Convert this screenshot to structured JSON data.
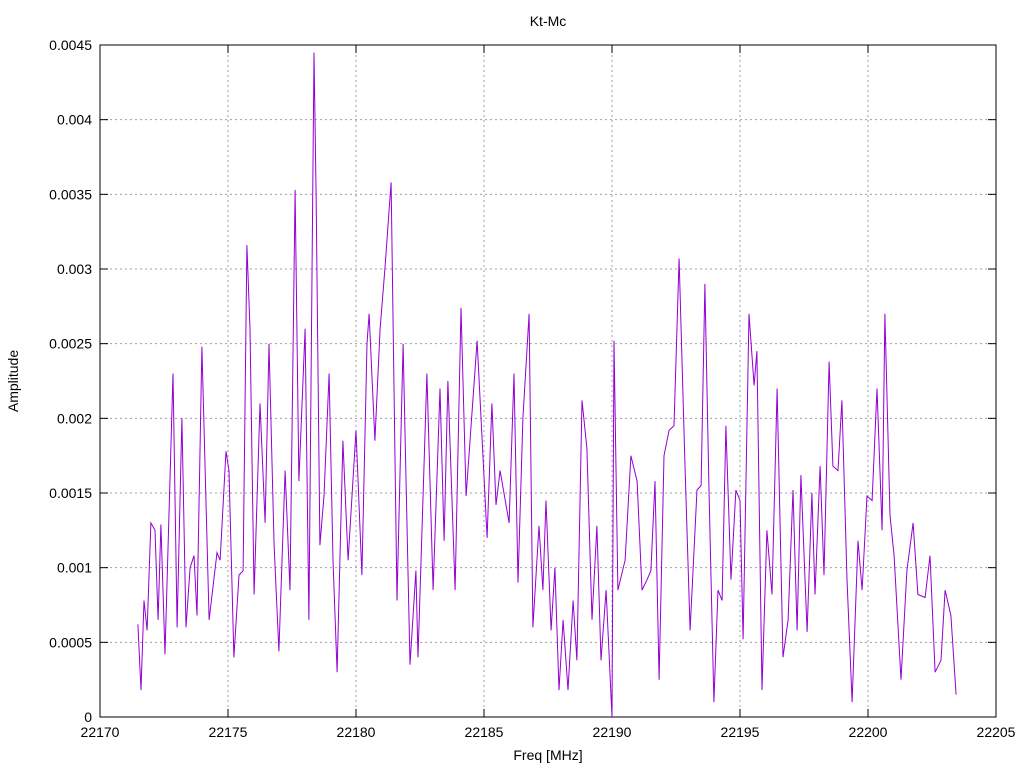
{
  "chart_data": {
    "type": "line",
    "title": "Kt-Mc",
    "xlabel": "Freq [MHz]",
    "ylabel": "Amplitude",
    "xlim": [
      22170,
      22205
    ],
    "ylim": [
      0,
      0.0045
    ],
    "xticks": [
      "22170",
      "22175",
      "22180",
      "22185",
      "22190",
      "22195",
      "22200",
      "22205"
    ],
    "yticks": [
      "0",
      "0.0005",
      "0.001",
      "0.0015",
      "0.002",
      "0.0025",
      "0.003",
      "0.0035",
      "0.004",
      "0.0045"
    ],
    "grid": true,
    "legend": "none",
    "series": [
      {
        "name": "Kt-Mc",
        "color": "#9400d3",
        "x": [
          22171.48,
          22171.6,
          22171.72,
          22171.84,
          22171.99,
          22172.15,
          22172.27,
          22172.38,
          22172.54,
          22172.66,
          22172.85,
          22173.01,
          22173.2,
          22173.36,
          22173.52,
          22173.67,
          22173.79,
          22173.98,
          22174.26,
          22174.57,
          22174.69,
          22174.92,
          22175.04,
          22175.23,
          22175.43,
          22175.59,
          22175.74,
          22175.86,
          22176.02,
          22176.25,
          22176.45,
          22176.6,
          22176.8,
          22176.99,
          22177.23,
          22177.42,
          22177.62,
          22177.77,
          22178.01,
          22178.16,
          22178.36,
          22178.44,
          22178.59,
          22178.75,
          22178.95,
          22179.1,
          22179.26,
          22179.49,
          22179.69,
          22180.0,
          22180.23,
          22180.43,
          22180.51,
          22180.74,
          22180.94,
          22181.13,
          22181.37,
          22181.6,
          22181.84,
          22182.11,
          22182.34,
          22182.42,
          22182.77,
          22183.01,
          22183.28,
          22183.44,
          22183.59,
          22183.87,
          22184.1,
          22184.3,
          22184.73,
          22185.12,
          22185.31,
          22185.47,
          22185.63,
          22185.98,
          22186.17,
          22186.33,
          22186.52,
          22186.76,
          22186.91,
          22187.15,
          22187.3,
          22187.42,
          22187.62,
          22187.77,
          22187.93,
          22188.09,
          22188.28,
          22188.48,
          22188.63,
          22188.83,
          22189.02,
          22189.22,
          22189.41,
          22189.57,
          22189.77,
          22190.0,
          22190.08,
          22190.23,
          22190.51,
          22190.74,
          22190.98,
          22191.17,
          22191.37,
          22191.52,
          22191.68,
          22191.84,
          22192.03,
          22192.23,
          22192.42,
          22192.62,
          22192.85,
          22193.05,
          22193.32,
          22193.48,
          22193.63,
          22193.79,
          22193.98,
          22194.14,
          22194.3,
          22194.45,
          22194.65,
          22194.84,
          22195.0,
          22195.12,
          22195.35,
          22195.55,
          22195.66,
          22195.86,
          22196.05,
          22196.25,
          22196.45,
          22196.68,
          22196.88,
          22197.07,
          22197.23,
          22197.38,
          22197.62,
          22197.81,
          22197.93,
          22198.13,
          22198.28,
          22198.48,
          22198.63,
          22198.83,
          22198.98,
          22199.18,
          22199.38,
          22199.61,
          22199.77,
          22199.96,
          22200.16,
          22200.35,
          22200.55,
          22200.66,
          22200.86,
          22201.02,
          22201.29,
          22201.52,
          22201.76,
          22201.95,
          22202.23,
          22202.42,
          22202.62,
          22202.85,
          22203.01,
          22203.24,
          22203.44
        ],
        "y": [
          0.00062,
          0.00018,
          0.00078,
          0.00058,
          0.0013,
          0.00125,
          0.00065,
          0.00129,
          0.00042,
          0.00115,
          0.0023,
          0.0006,
          0.002,
          0.0006,
          0.001,
          0.00108,
          0.00068,
          0.00248,
          0.00065,
          0.0011,
          0.00105,
          0.00178,
          0.00165,
          0.0004,
          0.00095,
          0.00098,
          0.00316,
          0.0026,
          0.00082,
          0.0021,
          0.0013,
          0.0025,
          0.00115,
          0.00044,
          0.00165,
          0.00085,
          0.00353,
          0.00158,
          0.0026,
          0.00065,
          0.00445,
          0.0035,
          0.00115,
          0.00148,
          0.0023,
          0.00105,
          0.0003,
          0.00185,
          0.00105,
          0.00192,
          0.00095,
          0.0025,
          0.0027,
          0.00185,
          0.0026,
          0.003,
          0.00358,
          0.00078,
          0.0025,
          0.00035,
          0.00098,
          0.0004,
          0.0023,
          0.00085,
          0.0022,
          0.00118,
          0.00225,
          0.00085,
          0.00274,
          0.00148,
          0.00252,
          0.0012,
          0.0021,
          0.00142,
          0.00165,
          0.0013,
          0.0023,
          0.0009,
          0.002,
          0.0027,
          0.0006,
          0.00128,
          0.00085,
          0.00145,
          0.00058,
          0.001,
          0.00018,
          0.00065,
          0.00018,
          0.00078,
          0.00038,
          0.00212,
          0.0018,
          0.00065,
          0.00128,
          0.00038,
          0.00085,
          0.0,
          0.00252,
          0.00085,
          0.00105,
          0.00175,
          0.00158,
          0.00085,
          0.00092,
          0.00098,
          0.00158,
          0.00025,
          0.00175,
          0.00192,
          0.00195,
          0.00307,
          0.00168,
          0.00058,
          0.00152,
          0.00155,
          0.0029,
          0.00152,
          0.0001,
          0.00085,
          0.00078,
          0.00195,
          0.00092,
          0.00152,
          0.00145,
          0.00052,
          0.0027,
          0.00222,
          0.00245,
          0.00018,
          0.00125,
          0.00082,
          0.0022,
          0.0004,
          0.00065,
          0.00152,
          0.00058,
          0.00162,
          0.00057,
          0.0015,
          0.00082,
          0.00168,
          0.00095,
          0.00238,
          0.00168,
          0.00165,
          0.00212,
          0.00092,
          0.0001,
          0.00118,
          0.00085,
          0.00148,
          0.00145,
          0.0022,
          0.00125,
          0.0027,
          0.00135,
          0.00108,
          0.00025,
          0.00098,
          0.0013,
          0.00082,
          0.0008,
          0.00108,
          0.0003,
          0.00038,
          0.00085,
          0.00068,
          0.00015
        ]
      }
    ]
  }
}
